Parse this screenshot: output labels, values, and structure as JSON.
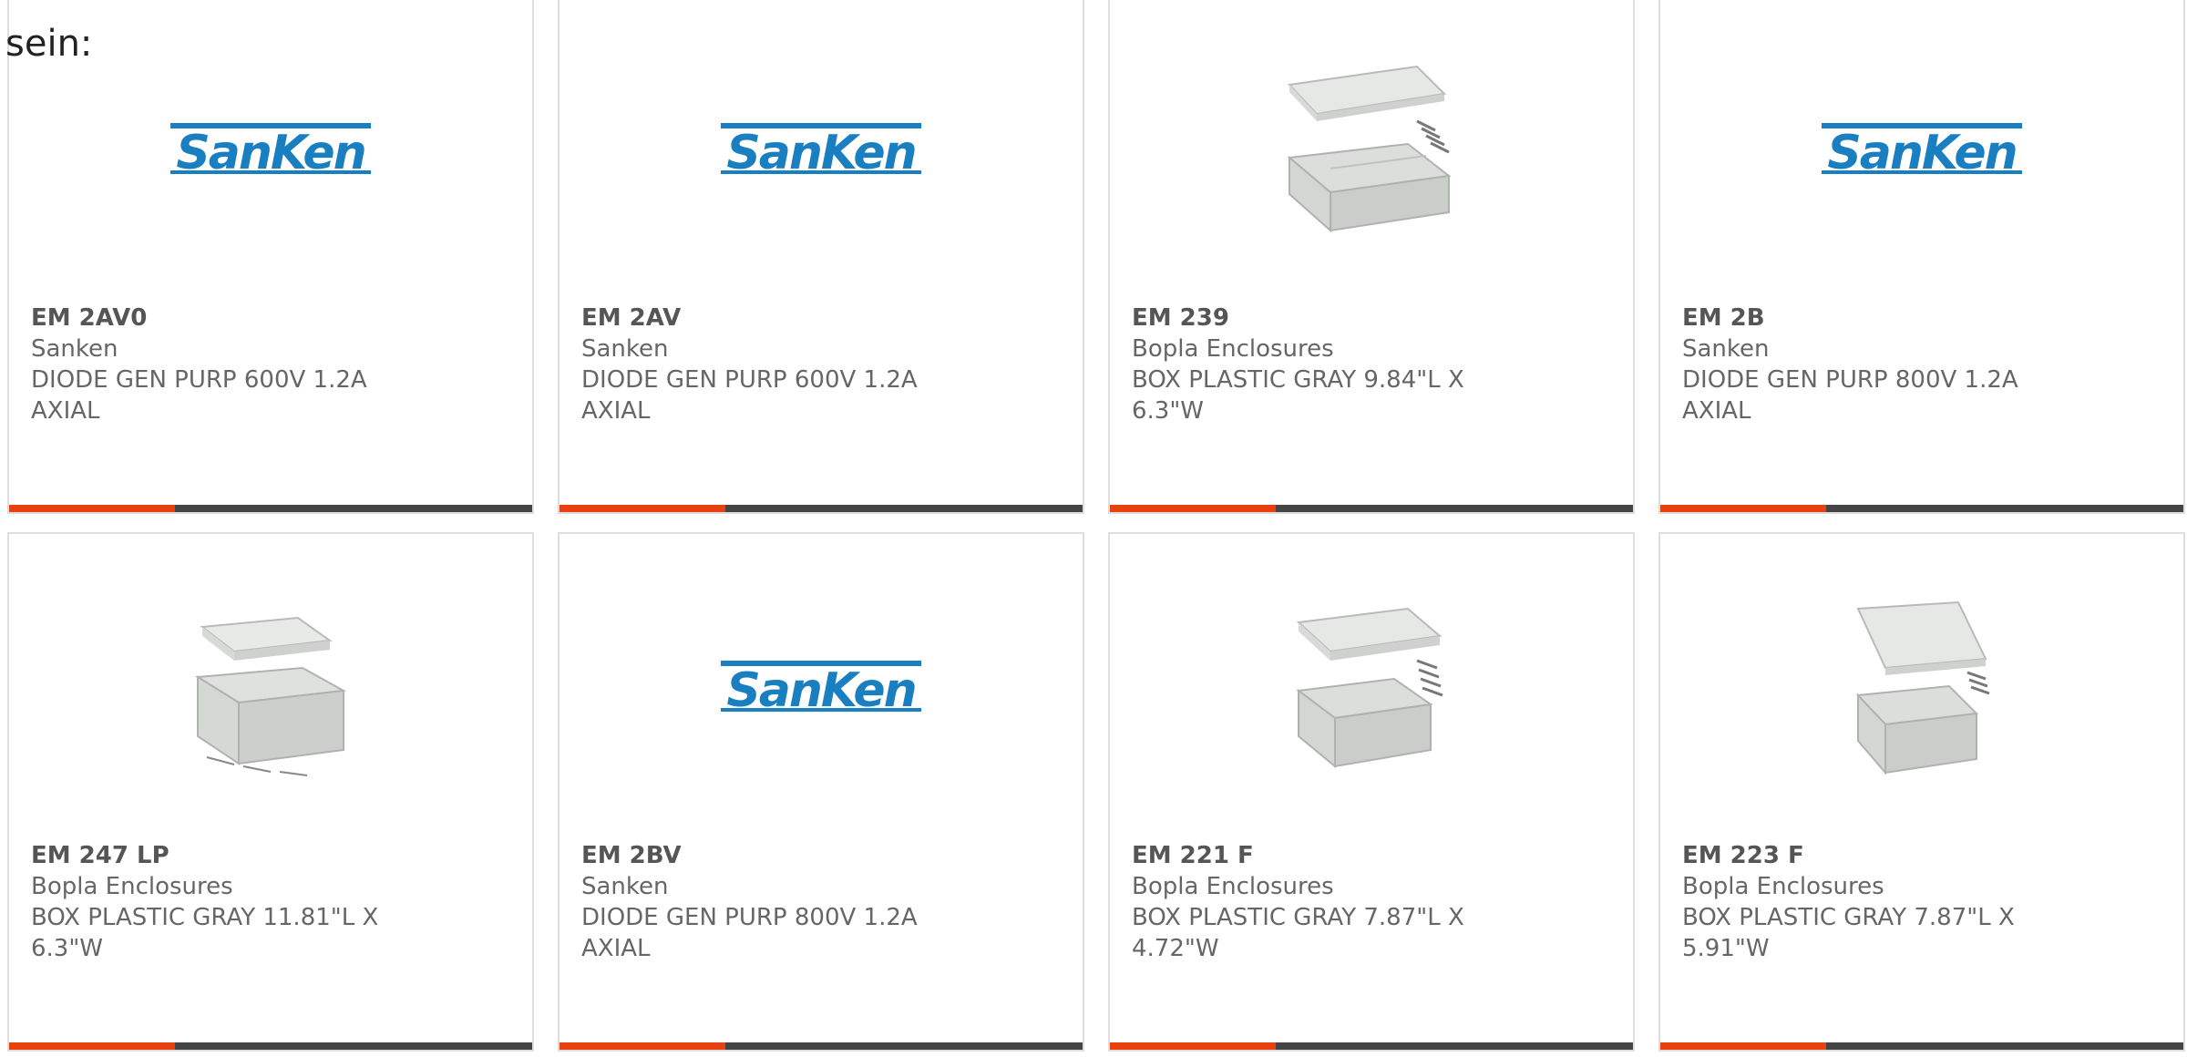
{
  "page": {
    "intro_text": "sein:"
  },
  "colors": {
    "accent": "#e8400e",
    "bar_dark": "#444444",
    "logo_blue": "#1a7fc1",
    "text_gray": "#666666"
  },
  "products": [
    {
      "part_number": "EM 2AV0",
      "manufacturer": "Sanken",
      "description": "DIODE GEN PURP 600V 1.2A AXIAL",
      "image": "sanken-logo",
      "logo_text": "SanKen"
    },
    {
      "part_number": "EM 2AV",
      "manufacturer": "Sanken",
      "description": "DIODE GEN PURP 600V 1.2A AXIAL",
      "image": "sanken-logo",
      "logo_text": "SanKen"
    },
    {
      "part_number": "EM 239",
      "manufacturer": "Bopla Enclosures",
      "description": "BOX PLASTIC GRAY 9.84\"L X 6.3\"W",
      "image": "plastic-enclosure-photo"
    },
    {
      "part_number": "EM 2B",
      "manufacturer": "Sanken",
      "description": "DIODE GEN PURP 800V 1.2A AXIAL",
      "image": "sanken-logo",
      "logo_text": "SanKen"
    },
    {
      "part_number": "EM 247 LP",
      "manufacturer": "Bopla Enclosures",
      "description": "BOX PLASTIC GRAY 11.81\"L X 6.3\"W",
      "image": "plastic-enclosure-photo"
    },
    {
      "part_number": "EM 2BV",
      "manufacturer": "Sanken",
      "description": "DIODE GEN PURP 800V 1.2A AXIAL",
      "image": "sanken-logo",
      "logo_text": "SanKen"
    },
    {
      "part_number": "EM 221 F",
      "manufacturer": "Bopla Enclosures",
      "description": "BOX PLASTIC GRAY 7.87\"L X 4.72\"W",
      "image": "plastic-enclosure-photo"
    },
    {
      "part_number": "EM 223 F",
      "manufacturer": "Bopla Enclosures",
      "description": "BOX PLASTIC GRAY 7.87\"L X 5.91\"W",
      "image": "plastic-enclosure-photo"
    }
  ]
}
